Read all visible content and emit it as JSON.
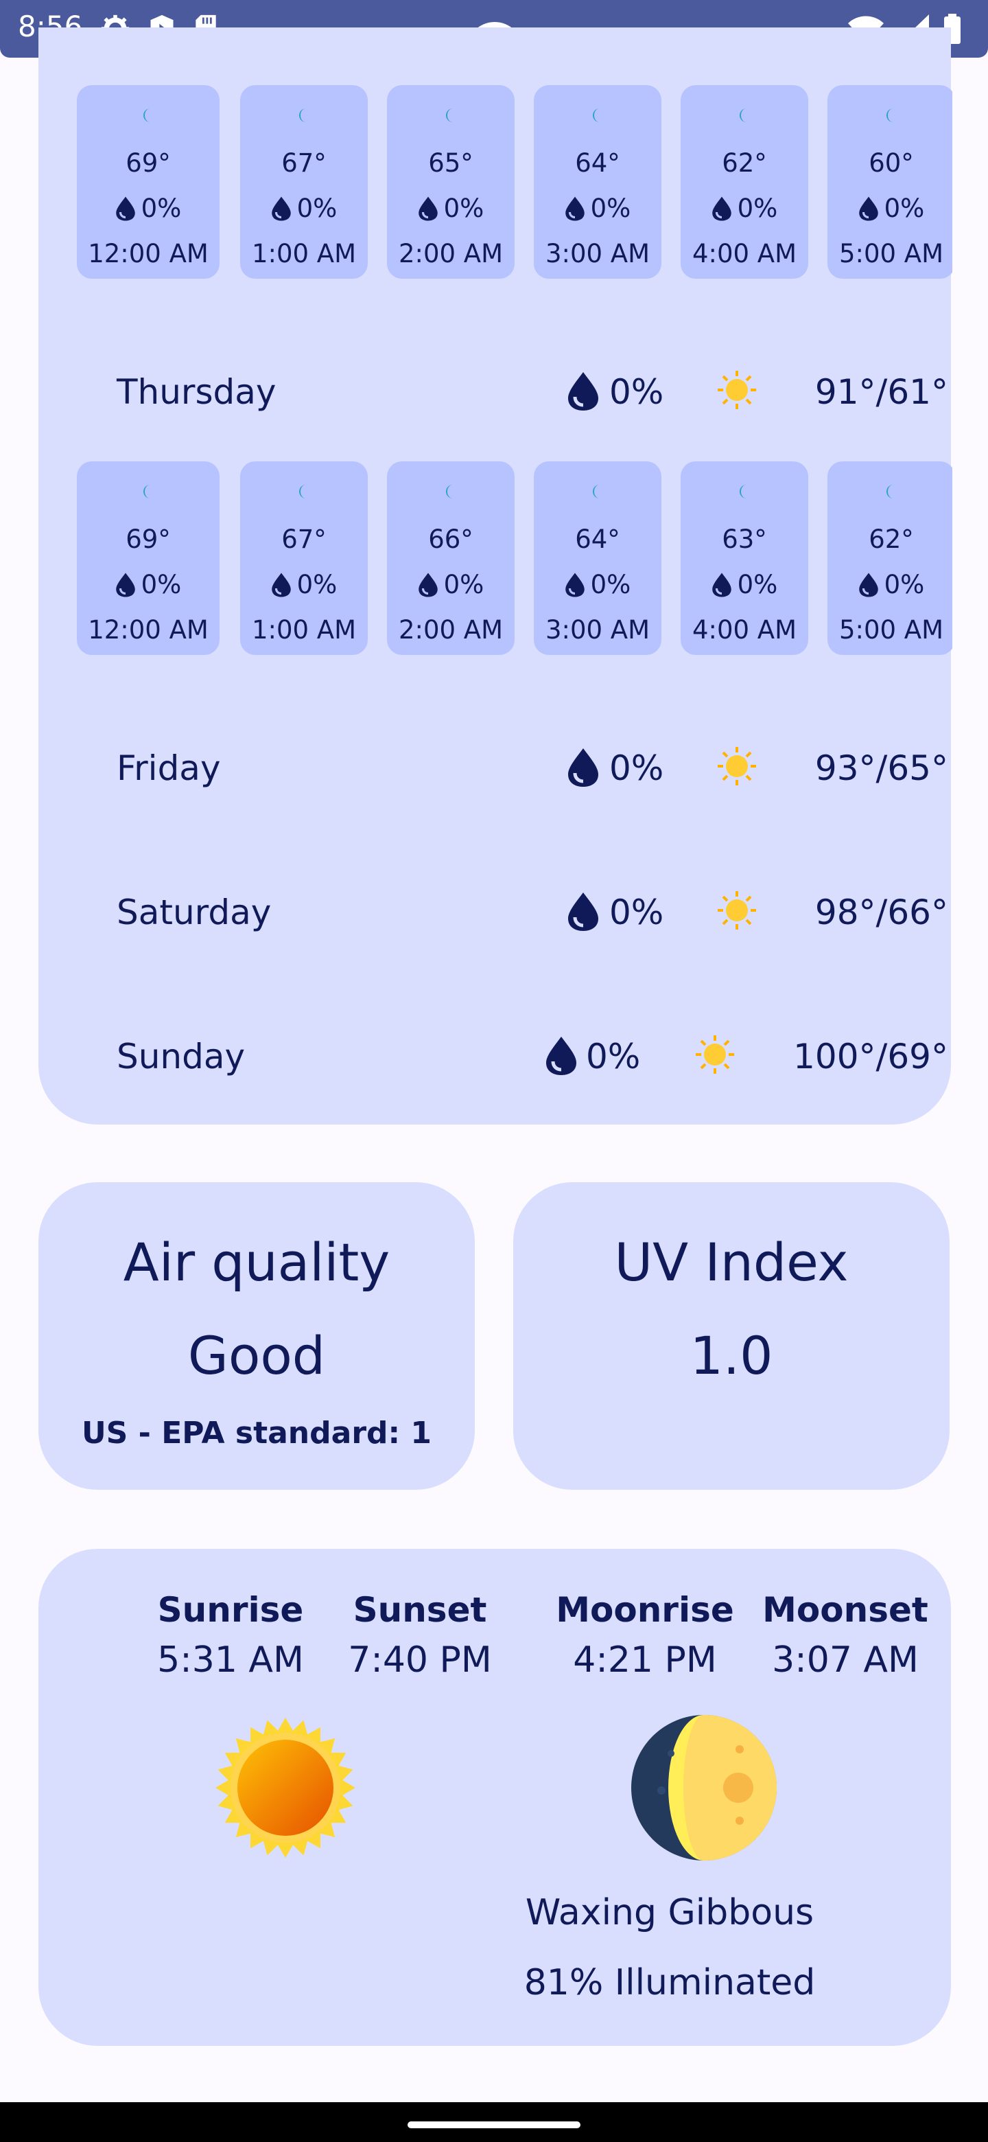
{
  "status_bar": {
    "time": "8:56",
    "left_icons": [
      "gear-icon",
      "shield-icon",
      "sd-card-icon"
    ],
    "right_icons": [
      "wifi-icon",
      "signal-icon",
      "battery-icon"
    ]
  },
  "forecast": {
    "hourly_row_1": [
      {
        "temp": "69°",
        "precip": "0%",
        "time": "12:00 AM"
      },
      {
        "temp": "67°",
        "precip": "0%",
        "time": "1:00 AM"
      },
      {
        "temp": "65°",
        "precip": "0%",
        "time": "2:00 AM"
      },
      {
        "temp": "64°",
        "precip": "0%",
        "time": "3:00 AM"
      },
      {
        "temp": "62°",
        "precip": "0%",
        "time": "4:00 AM"
      },
      {
        "temp": "60°",
        "precip": "0%",
        "time": "5:00 AM"
      }
    ],
    "hourly_row_2": [
      {
        "temp": "69°",
        "precip": "0%",
        "time": "12:00 AM"
      },
      {
        "temp": "67°",
        "precip": "0%",
        "time": "1:00 AM"
      },
      {
        "temp": "66°",
        "precip": "0%",
        "time": "2:00 AM"
      },
      {
        "temp": "64°",
        "precip": "0%",
        "time": "3:00 AM"
      },
      {
        "temp": "63°",
        "precip": "0%",
        "time": "4:00 AM"
      },
      {
        "temp": "62°",
        "precip": "0%",
        "time": "5:00 AM"
      }
    ],
    "days": [
      {
        "name": "Thursday",
        "precip": "0%",
        "hilo": "91°/61°"
      },
      {
        "name": "Friday",
        "precip": "0%",
        "hilo": "93°/65°"
      },
      {
        "name": "Saturday",
        "precip": "0%",
        "hilo": "98°/66°"
      },
      {
        "name": "Sunday",
        "precip": "0%",
        "hilo": "100°/69°"
      }
    ]
  },
  "air_quality": {
    "title": "Air quality",
    "value": "Good",
    "detail": "US - EPA standard: 1"
  },
  "uv_index": {
    "title": "UV Index",
    "value": "1.0"
  },
  "astronomy": {
    "sunrise_label": "Sunrise",
    "sunrise": "5:31 AM",
    "sunset_label": "Sunset",
    "sunset": "7:40 PM",
    "moonrise_label": "Moonrise",
    "moonrise": "4:21 PM",
    "moonset_label": "Moonset",
    "moonset": "3:07 AM",
    "moon_phase": "Waxing Gibbous",
    "illumination": "81% Illuminated"
  },
  "colors": {
    "card": "#d9defe",
    "hour_card": "#b7c3ff",
    "text": "#101a58",
    "status_bar": "#4a5a9c"
  }
}
